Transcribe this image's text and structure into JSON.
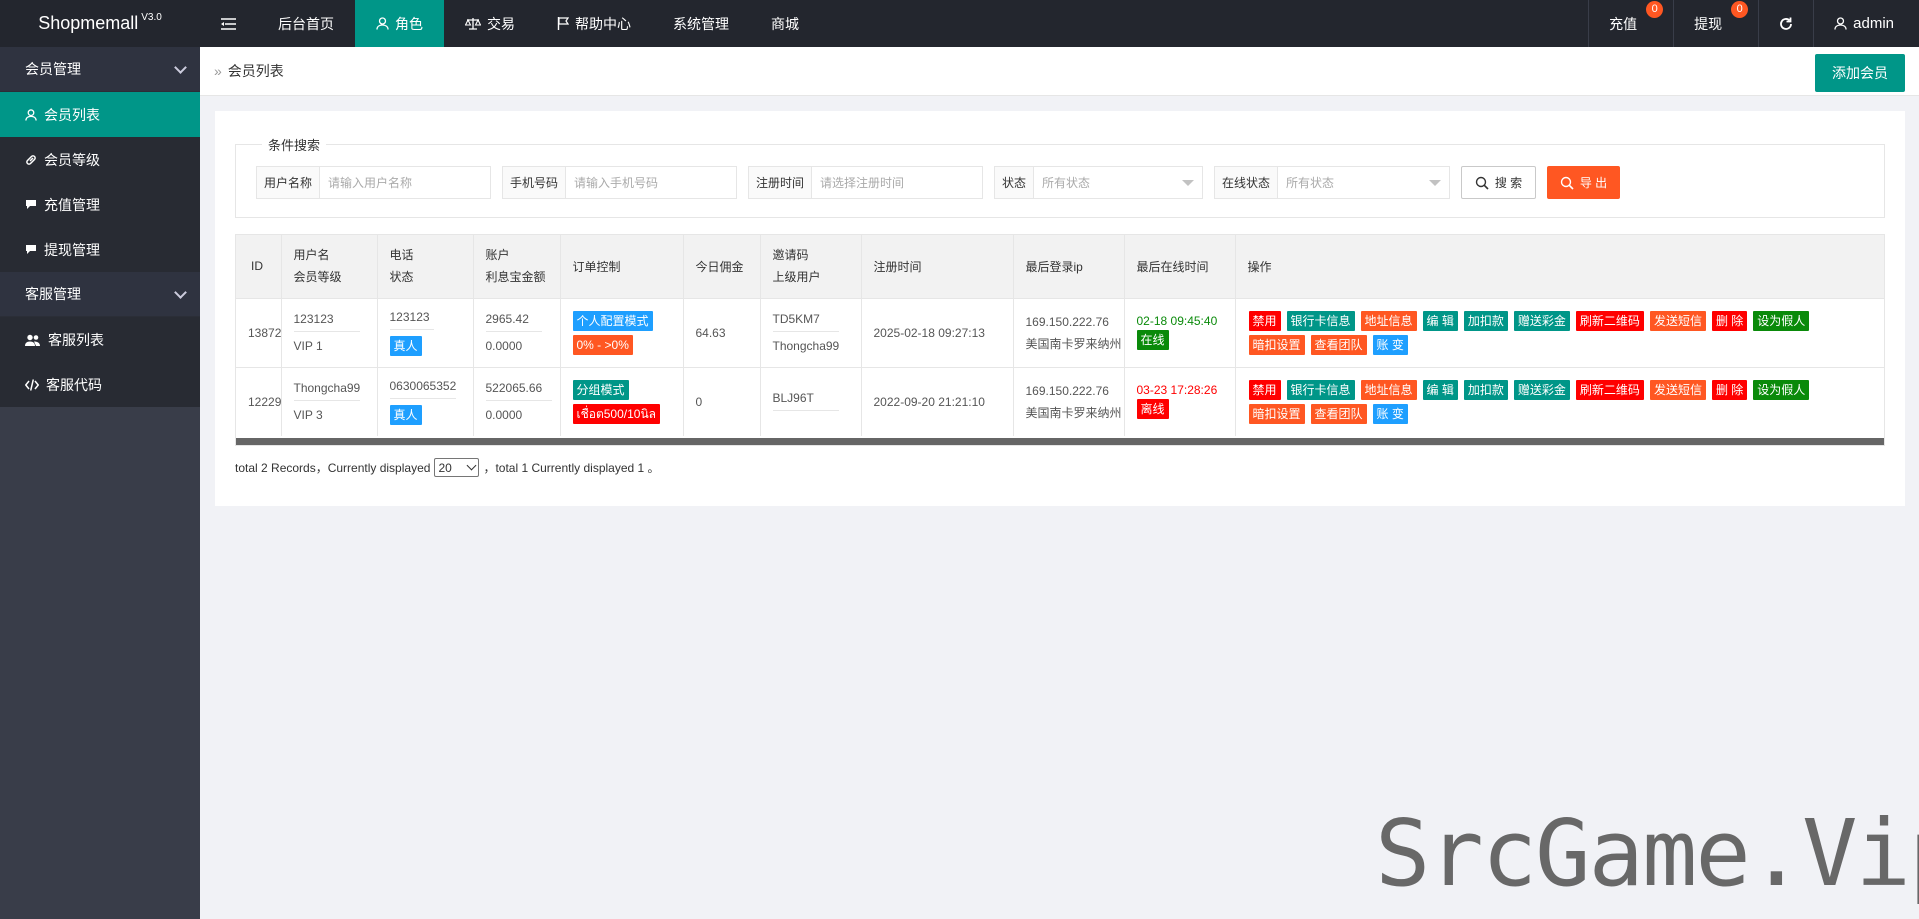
{
  "topbar": {
    "logo": "Shopmemall",
    "version": "V3.0",
    "nav": [
      "后台首页",
      "角色",
      "交易",
      "帮助中心",
      "系统管理",
      "商城"
    ],
    "active_nav": "角色",
    "recharge": "充值",
    "recharge_badge": "0",
    "withdraw": "提现",
    "withdraw_badge": "0",
    "user": "admin"
  },
  "sidebar": {
    "groups": [
      {
        "label": "会员管理",
        "items": [
          "会员列表",
          "会员等级",
          "充值管理",
          "提现管理"
        ]
      },
      {
        "label": "客服管理",
        "items": [
          "客服列表",
          "客服代码"
        ]
      }
    ],
    "active": "会员列表"
  },
  "header": {
    "breadcrumb": "会员列表",
    "add_button": "添加会员"
  },
  "search": {
    "legend": "条件搜索",
    "username_label": "用户名称",
    "username_placeholder": "请输入用户名称",
    "phone_label": "手机号码",
    "phone_placeholder": "请输入手机号码",
    "regtime_label": "注册时间",
    "regtime_placeholder": "请选择注册时间",
    "status_label": "状态",
    "status_value": "所有状态",
    "online_label": "在线状态",
    "online_value": "所有状态",
    "search_button": "搜 索",
    "export_button": "导 出"
  },
  "table": {
    "headers": {
      "id": "ID",
      "user_a": "用户名",
      "user_b": "会员等级",
      "phone_a": "电话",
      "phone_b": "状态",
      "acct_a": "账户",
      "acct_b": "利息宝金额",
      "order": "订单控制",
      "commission": "今日佣金",
      "invite_a": "邀请码",
      "invite_b": "上级用户",
      "regtime": "注册时间",
      "lastip": "最后登录ip",
      "lastonline": "最后在线时间",
      "ops": "操作"
    },
    "rows": [
      {
        "id": "13872",
        "username": "123123",
        "level": "VIP 1",
        "phone": "123123",
        "status": "真人",
        "balance": "2965.42",
        "interest": "0.0000",
        "mode": "个人配置模式",
        "mode_range": "0% - >0%",
        "commission": "64.63",
        "invite": "TD5KM7",
        "parent": "Thongcha99",
        "regtime": "2025-02-18 09:27:13",
        "ip": "169.150.222.76",
        "location": "美国南卡罗来纳州",
        "online_time": "02-18 09:45:40",
        "online_status": "在线"
      },
      {
        "id": "12229",
        "username": "Thongcha99",
        "level": "VIP 3",
        "phone": "0630065352",
        "status": "真人",
        "balance": "522065.66",
        "interest": "0.0000",
        "mode": "分组模式",
        "mode_range": "เชื่อต500/10นิล",
        "commission": "0",
        "invite": "BLJ96T",
        "parent": "",
        "regtime": "2022-09-20 21:21:10",
        "ip": "169.150.222.76",
        "location": "美国南卡罗来纳州",
        "online_time": "03-23 17:28:26",
        "online_status": "离线"
      }
    ],
    "actions": {
      "disable": "禁用",
      "bankcard": "银行卡信息",
      "address": "地址信息",
      "edit": "编 辑",
      "adjust": "加扣款",
      "gift": "赠送彩金",
      "qrcode": "刷新二维码",
      "sms": "发送短信",
      "delete": "删 除",
      "fake": "设为假人",
      "hidden_deduct": "暗扣设置",
      "team": "查看团队",
      "account_change": "账 变"
    }
  },
  "pager": {
    "text_a": "total 2 Records，Currently displayed",
    "per_page": "20",
    "text_b": "，total 1 Currently displayed 1 。"
  },
  "watermark": "SrcGame.Vip",
  "colors": {
    "primary": "#009688",
    "danger": "#ff5722",
    "info": "#1e9fff",
    "red": "#ff0000",
    "green": "#0a8a0a"
  }
}
